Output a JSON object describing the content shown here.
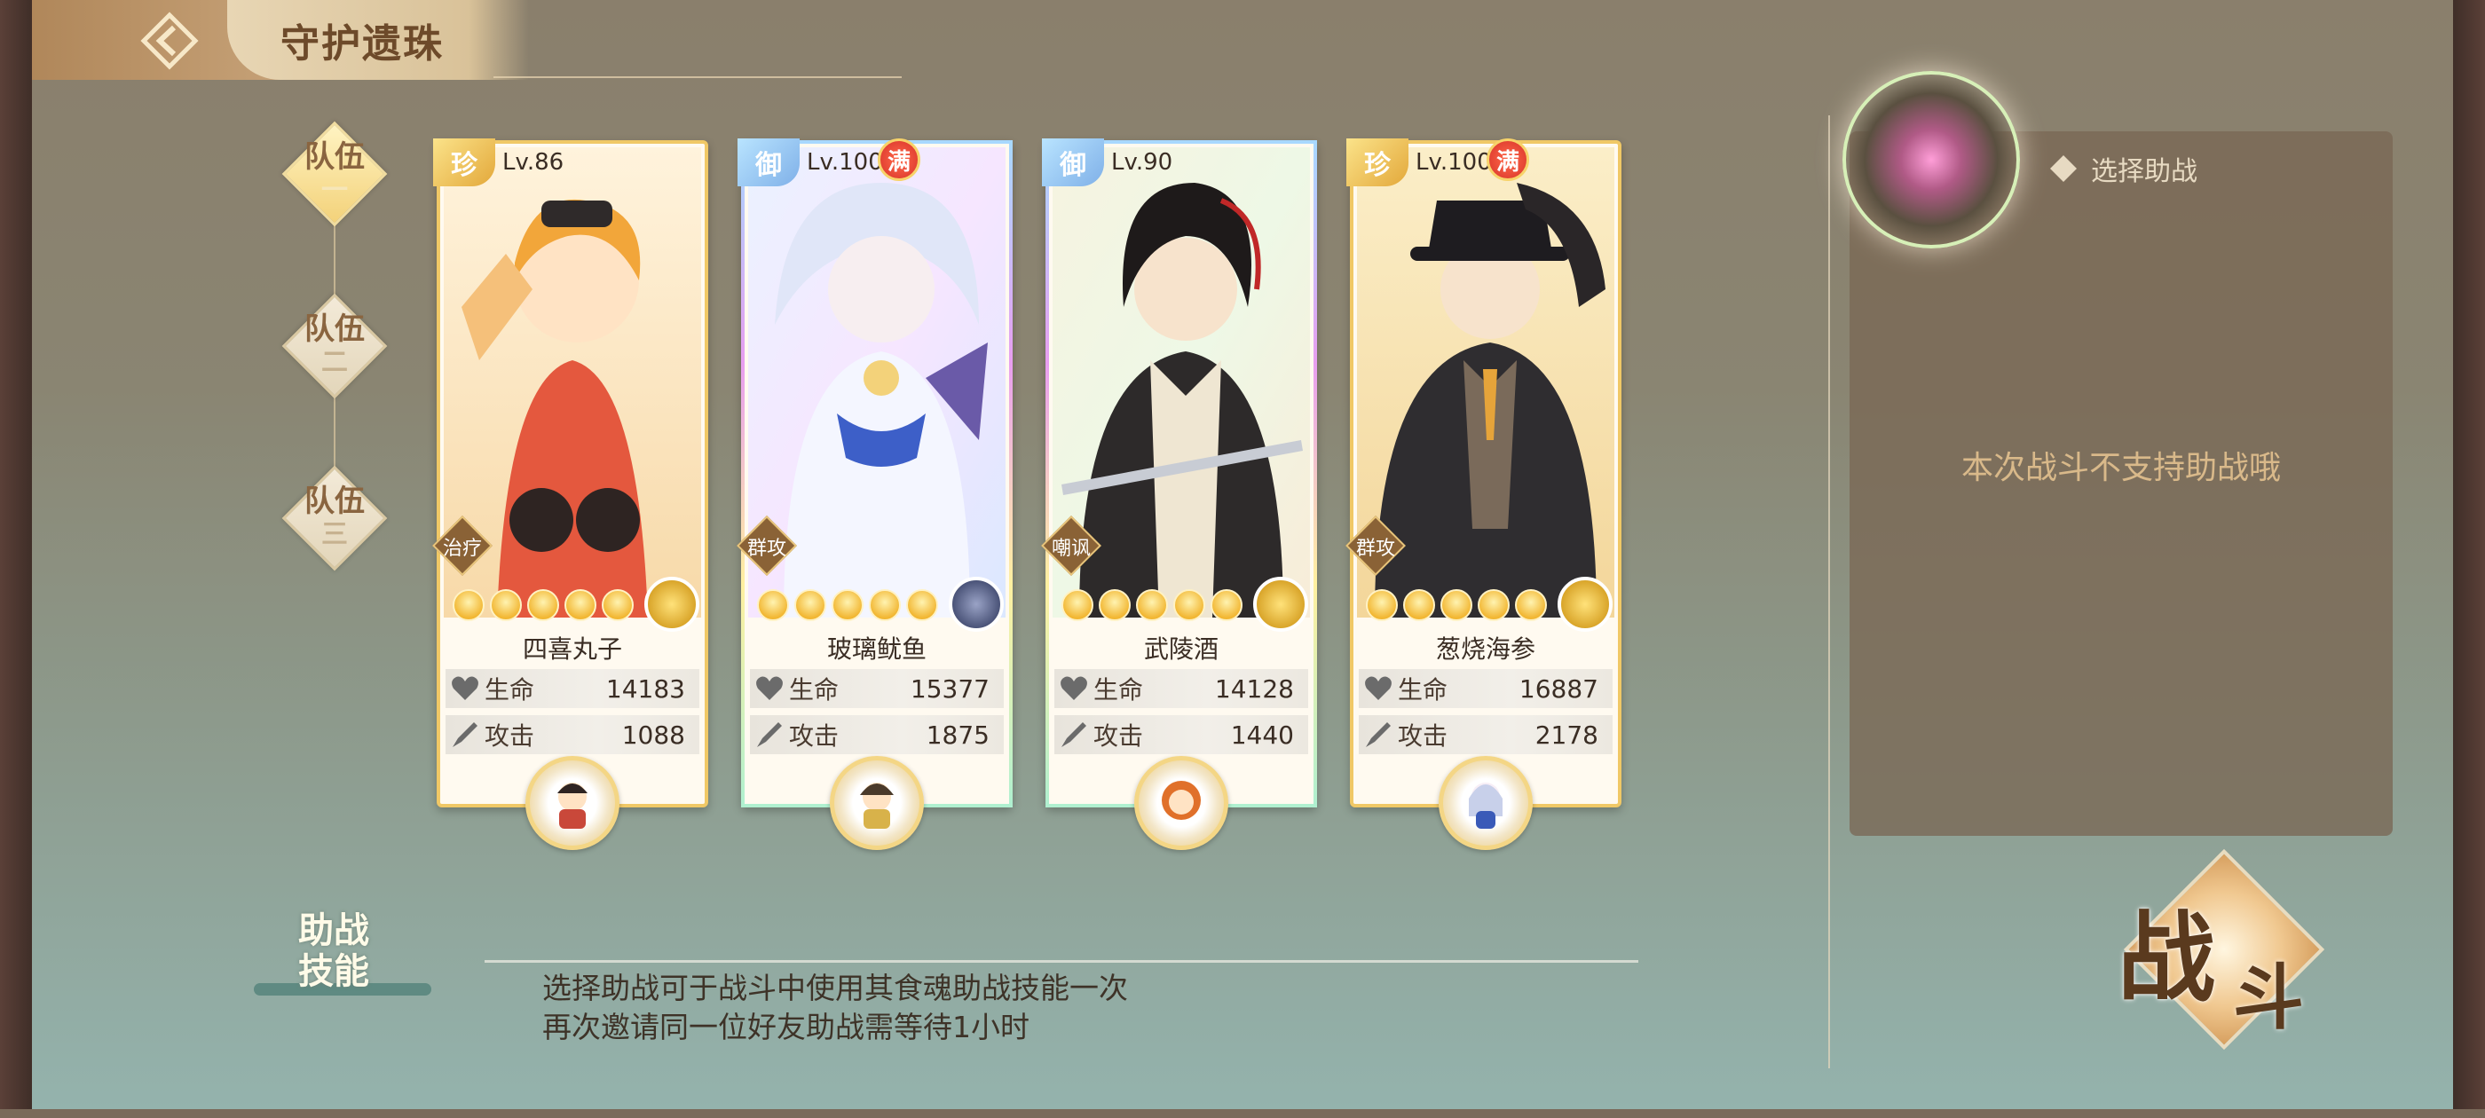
{
  "header": {
    "title": "守护遗珠"
  },
  "teams": [
    {
      "label": "队伍",
      "sub": "一",
      "active": true
    },
    {
      "label": "队伍",
      "sub": "二",
      "active": false
    },
    {
      "label": "队伍",
      "sub": "三",
      "active": false
    }
  ],
  "cards": [
    {
      "rarity": "珍",
      "level": "Lv.86",
      "max": "",
      "role": "治疗",
      "name": "四喜丸子",
      "hp_label": "生命",
      "hp": "14183",
      "atk_label": "攻击",
      "atk": "1088",
      "stars": 5
    },
    {
      "rarity": "御",
      "level": "Lv.100",
      "max": "满",
      "role": "群攻",
      "name": "玻璃鱿鱼",
      "hp_label": "生命",
      "hp": "15377",
      "atk_label": "攻击",
      "atk": "1875",
      "stars": 5
    },
    {
      "rarity": "御",
      "level": "Lv.90",
      "max": "",
      "role": "嘲讽",
      "name": "武陵酒",
      "hp_label": "生命",
      "hp": "14128",
      "atk_label": "攻击",
      "atk": "1440",
      "stars": 5
    },
    {
      "rarity": "珍",
      "level": "Lv.100",
      "max": "满",
      "role": "群攻",
      "name": "葱烧海参",
      "hp_label": "生命",
      "hp": "16887",
      "atk_label": "攻击",
      "atk": "2178",
      "stars": 5
    }
  ],
  "helper": {
    "title": "选择助战",
    "message": "本次战斗不支持助战哦"
  },
  "skill": {
    "label_line1": "助战",
    "label_line2": "技能",
    "line1": "选择助战可于战斗中使用其食魂助战技能一次",
    "line2": "再次邀请同一位好友助战需等待1小时"
  },
  "battle": {
    "char1": "战",
    "char2": "斗"
  },
  "colors": {
    "card_border_gold": "#f0c866",
    "accent_text": "#d9b98a"
  }
}
